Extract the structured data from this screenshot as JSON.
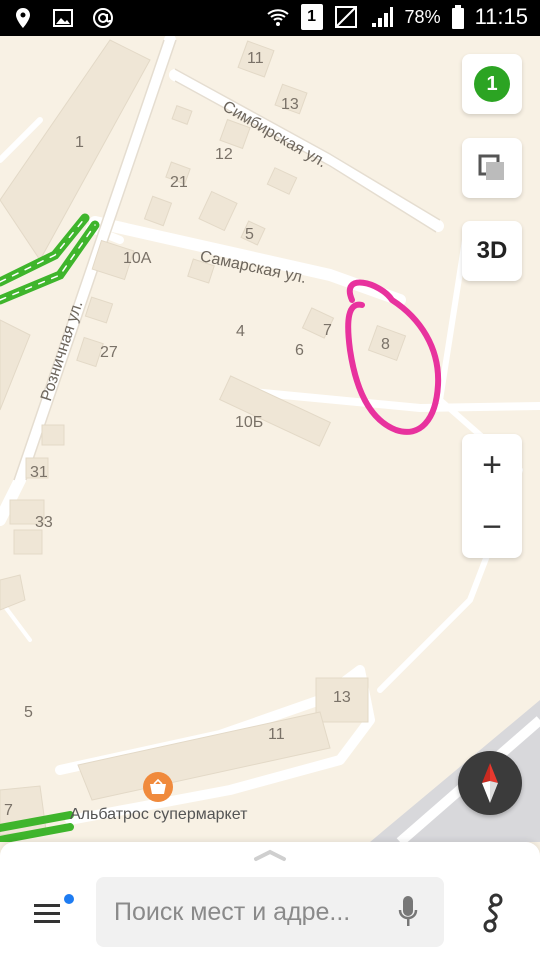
{
  "status_bar": {
    "left_icons": [
      "location-icon",
      "gallery-icon",
      "at-sign-icon"
    ],
    "sim_slot": "1",
    "battery_percent": "78%",
    "time": "11:15"
  },
  "map": {
    "streets": [
      {
        "name": "Симбирская ул."
      },
      {
        "name": "Самарская ул."
      },
      {
        "name": "Розничная ул."
      }
    ],
    "house_numbers": [
      "11",
      "13",
      "1",
      "12",
      "21",
      "5",
      "10А",
      "4",
      "7",
      "6",
      "8",
      "27",
      "10Б",
      "31",
      "33",
      "5",
      "13",
      "11",
      "7"
    ],
    "poi": {
      "name": "Альбатрос супермаркет",
      "icon": "shopping-basket-icon",
      "color": "#f08a3c"
    },
    "annotation": {
      "shape": "freehand-circle",
      "color": "#e8329e"
    },
    "traffic_color": "#3fb52c"
  },
  "controls": {
    "traffic_level": "1",
    "layers_icon": "layers-icon",
    "view_3d": "3D",
    "zoom_in": "+",
    "zoom_out": "−",
    "compass_icon": "compass-icon"
  },
  "bottom_panel": {
    "menu_icon": "menu-icon",
    "search_placeholder": "Поиск мест и адре...",
    "mic_icon": "microphone-icon",
    "route_icon": "route-icon"
  }
}
